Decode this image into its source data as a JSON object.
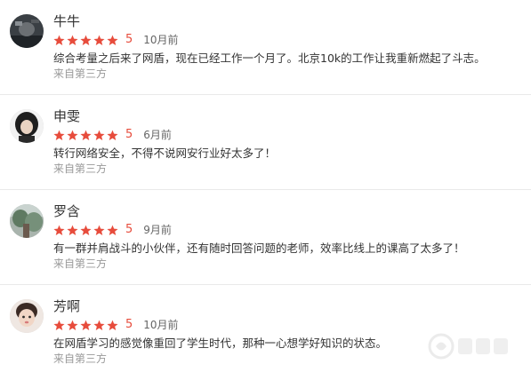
{
  "reviews": [
    {
      "name": "牛牛",
      "score": "5",
      "time": "10月前",
      "comment": "综合考量之后来了网盾，现在已经工作一个月了。北京10k的工作让我重新燃起了斗志。",
      "source": "来自第三方",
      "avatar_icon": "avatar-dark-photo"
    },
    {
      "name": "申雯",
      "score": "5",
      "time": "6月前",
      "comment": "转行网络安全，不得不说网安行业好太多了！",
      "source": "来自第三方",
      "avatar_icon": "avatar-girl-dark-hair"
    },
    {
      "name": "罗含",
      "score": "5",
      "time": "9月前",
      "comment": "有一群并肩战斗的小伙伴，还有随时回答问题的老师，效率比线上的课高了太多了！",
      "source": "来自第三方",
      "avatar_icon": "avatar-outdoor-photo"
    },
    {
      "name": "芳啊",
      "score": "5",
      "time": "10月前",
      "comment": "在网盾学习的感觉像重回了学生时代，那种一心想学好知识的状态。",
      "source": "来自第三方",
      "avatar_icon": "avatar-child-photo"
    }
  ],
  "star_count": 5,
  "colors": {
    "star": "#e74c3c",
    "score": "#e74c3c",
    "text": "#333333",
    "muted": "#999999",
    "divider": "#e9e9e9"
  },
  "watermark_icon": "site-logo-watermark"
}
